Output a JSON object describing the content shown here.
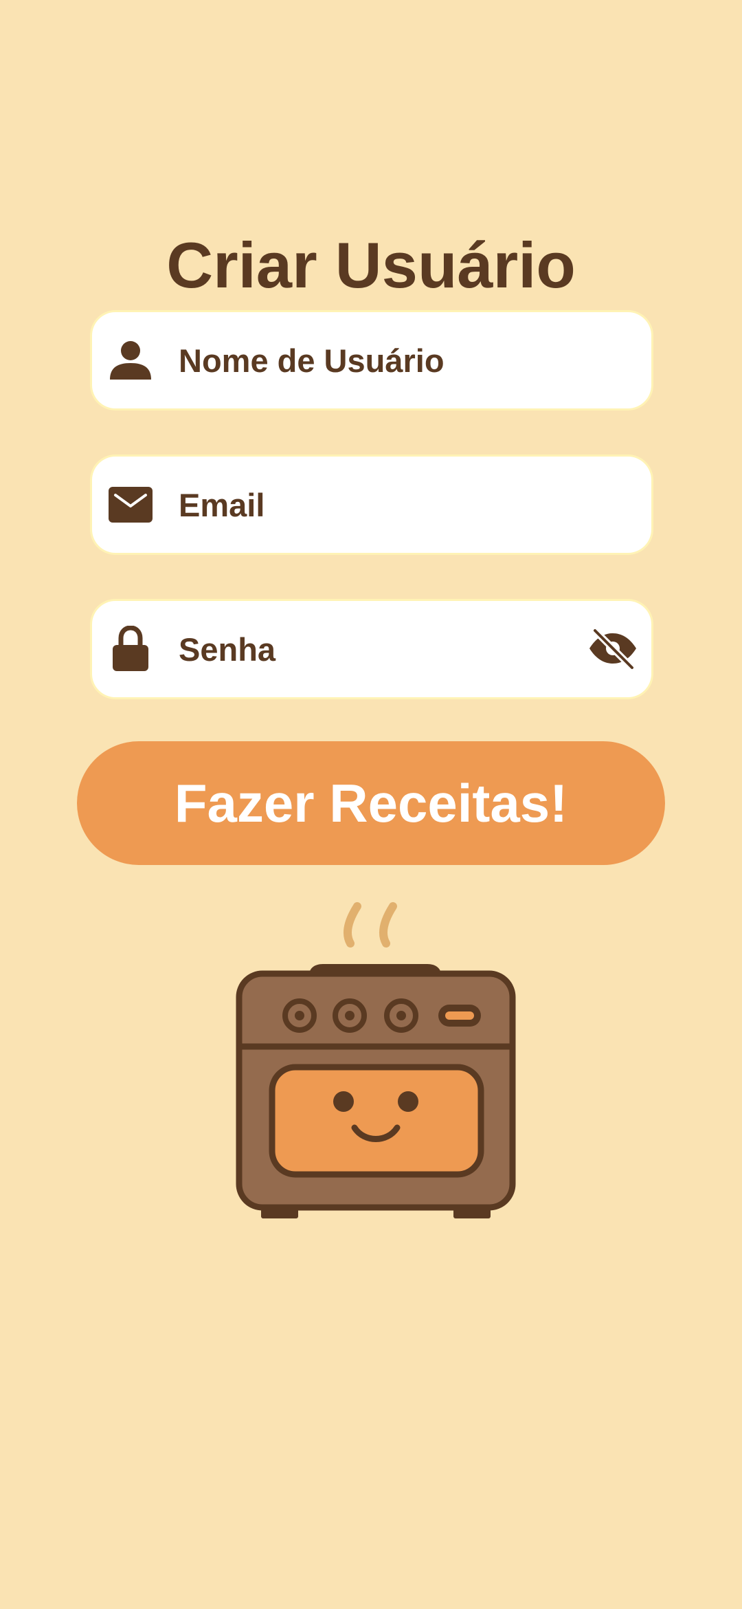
{
  "page": {
    "title": "Criar Usuário"
  },
  "form": {
    "username": {
      "placeholder": "Nome de Usuário",
      "value": "",
      "icon": "person-icon"
    },
    "email": {
      "placeholder": "Email",
      "value": "",
      "icon": "mail-icon"
    },
    "password": {
      "placeholder": "Senha",
      "value": "",
      "icon": "lock-icon",
      "toggle_icon": "eye-off-icon"
    },
    "submit_label": "Fazer Receitas!"
  },
  "illustration": {
    "icon": "smiling-oven-icon"
  },
  "colors": {
    "background": "#FAE3B3",
    "text": "#5A3A22",
    "accent": "#EE9A52",
    "field": "#FFFFFF"
  }
}
